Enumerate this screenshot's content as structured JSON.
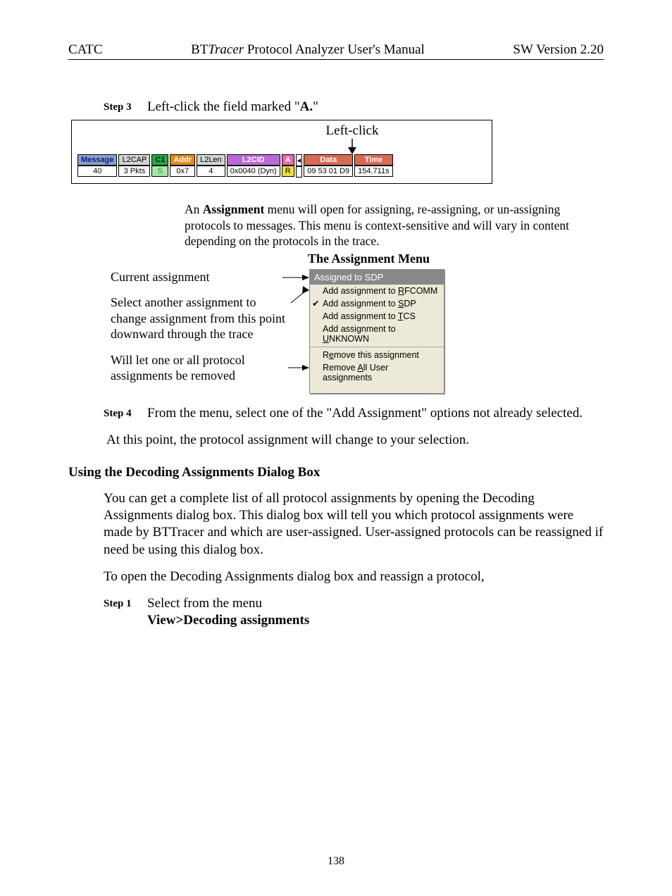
{
  "header": {
    "left": "CATC",
    "center_pre": "BT",
    "center_em": "Tracer",
    "center_post": " Protocol Analyzer User's Manual",
    "right": "SW Version 2.20"
  },
  "step3": {
    "label": "Step 3",
    "text_pre": "Left-click the field marked \"",
    "bold": "A.",
    "text_post": "\""
  },
  "fig1": {
    "label": "Left-click"
  },
  "trace": {
    "cols": [
      {
        "hdr": "Message",
        "val": "40",
        "hStyle": "h-blue",
        "vStyle": "v-white",
        "hColor": "#0a1a8a",
        "vColor": "#2a3a9a"
      },
      {
        "hdr": "L2CAP",
        "val": "3 Pkts",
        "hStyle": "h-lgray"
      },
      {
        "hdr": "C1",
        "val": "S",
        "hStyle": "h-green",
        "vStyle": "h-green-l"
      },
      {
        "hdr": "Addr",
        "val": "0x7",
        "hStyle": "h-orange"
      },
      {
        "hdr": "L2Len",
        "val": "4",
        "hStyle": "h-lgray"
      },
      {
        "hdr": "L2CID",
        "val": "0x0040 (Dyn)",
        "hStyle": "h-purple"
      },
      {
        "hdr": "A",
        "val": "R",
        "hStyle": "h-pink",
        "vStyle": "h-yellow"
      },
      {
        "hdr": "◂",
        "val": "",
        "hStyle": "v-white",
        "narrow": true
      },
      {
        "hdr": "Data",
        "val": "09 53 01 D9",
        "hStyle": "h-red"
      },
      {
        "hdr": "Time",
        "val": "154.711s",
        "hStyle": "h-red"
      }
    ]
  },
  "para_assign": {
    "pre": "An ",
    "b": "Assignment",
    "post": " menu will open for assigning, re-assigning, or un-assigning protocols to messages.  This menu is context-sensitive and will vary in content depending on the protocols in the trace."
  },
  "menu_title": "The Assignment Menu",
  "annotations": {
    "a1": "Current assignment",
    "a2": "Select another assignment to change assignment from this point downward through the trace",
    "a3": "Will let one or all protocol assignments be removed"
  },
  "menu": {
    "title": "Assigned to SDP",
    "items1": [
      {
        "pre": "Add assignment to ",
        "u": "R",
        "post": "FCOMM",
        "check": false
      },
      {
        "pre": "Add assignment to ",
        "u": "S",
        "post": "DP",
        "check": true
      },
      {
        "pre": "Add assignment to ",
        "u": "T",
        "post": "CS",
        "check": false
      },
      {
        "pre": "Add assignment to ",
        "u": "U",
        "post": "NKNOWN",
        "check": false
      }
    ],
    "items2": [
      {
        "pre": "R",
        "u": "e",
        "post": "move this assignment"
      },
      {
        "pre": "Remove ",
        "u": "A",
        "post": "ll User assignments"
      }
    ]
  },
  "step4": {
    "label": "Step 4",
    "text": "From the menu, select one of the \"Add Assignment\" options not already selected."
  },
  "para_atpoint": "At this point, the protocol assignment will change to your selection.",
  "section": "Using the Decoding Assignments Dialog Box",
  "para_dialog": "You can get a complete list of all protocol assignments by opening the Decoding Assignments dialog box.  This dialog box will tell you which protocol assignments were made by BTTracer and which are user-assigned.  User-assigned protocols can be reassigned if need be using this dialog box.",
  "para_toopen": "To open the Decoding Assignments dialog box and reassign a protocol,",
  "step1": {
    "label": "Step 1",
    "line1": "Select from the menu",
    "line2": "View>Decoding assignments"
  },
  "pagenum": "138"
}
